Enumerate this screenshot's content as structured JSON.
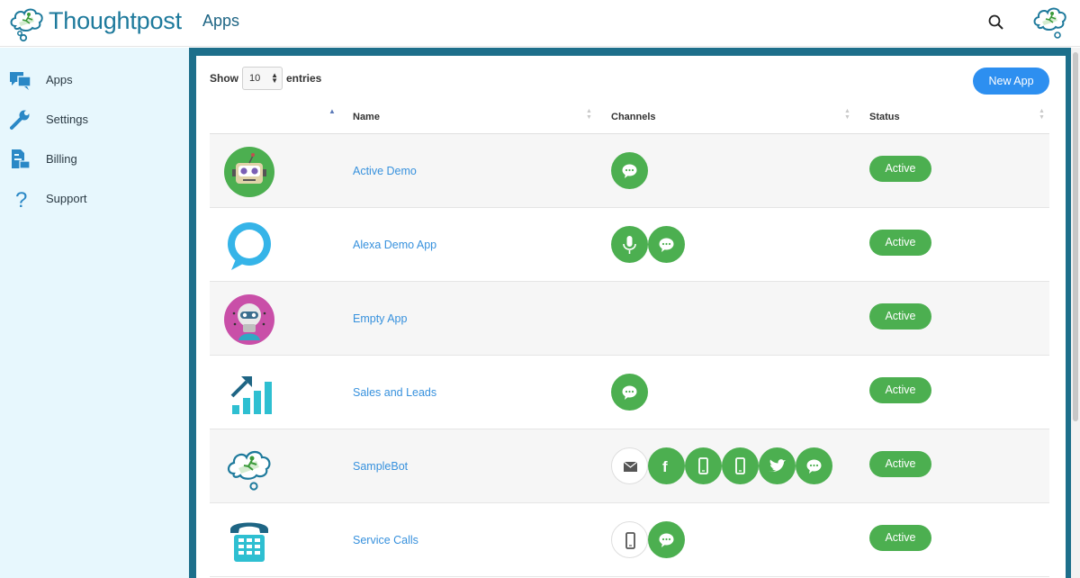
{
  "header": {
    "brand": "Thoughtpost",
    "page_title": "Apps",
    "logo_icon": "cloud-runner-logo-icon",
    "search_icon": "search-icon"
  },
  "sidebar": {
    "items": [
      {
        "label": "Apps",
        "icon": "chat-bubbles-icon"
      },
      {
        "label": "Settings",
        "icon": "wrench-icon"
      },
      {
        "label": "Billing",
        "icon": "invoice-icon"
      },
      {
        "label": "Support",
        "icon": "question-mark-icon"
      }
    ]
  },
  "table": {
    "show_label": "Show",
    "page_size": "10",
    "entries_label": "entries",
    "new_app_label": "New App",
    "columns": {
      "name": "Name",
      "channels": "Channels",
      "status": "Status"
    },
    "rows": [
      {
        "name": "Active Demo",
        "icon": "robot-face-icon",
        "channels": [
          "chat"
        ],
        "status": "Active"
      },
      {
        "name": "Alexa Demo App",
        "icon": "alexa-ring-icon",
        "channels": [
          "voice",
          "chat"
        ],
        "status": "Active"
      },
      {
        "name": "Empty App",
        "icon": "robot-avatar-icon",
        "channels": [],
        "status": "Active"
      },
      {
        "name": "Sales and Leads",
        "icon": "growth-chart-icon",
        "channels": [
          "chat"
        ],
        "status": "Active"
      },
      {
        "name": "SampleBot",
        "icon": "cloud-runner-icon",
        "channels": [
          "email",
          "facebook",
          "mobile",
          "mobile",
          "twitter",
          "chat"
        ],
        "status": "Active"
      },
      {
        "name": "Service Calls",
        "icon": "telephone-icon",
        "channels": [
          "mobile",
          "chat"
        ],
        "status": "Active"
      }
    ]
  },
  "colors": {
    "brand": "#1e7a9c",
    "sidebar_bg": "#e7f7fd",
    "frame": "#1d6f8b",
    "primary_button": "#2d8ff0",
    "channel_green": "#4caf50",
    "link": "#3791dd"
  }
}
